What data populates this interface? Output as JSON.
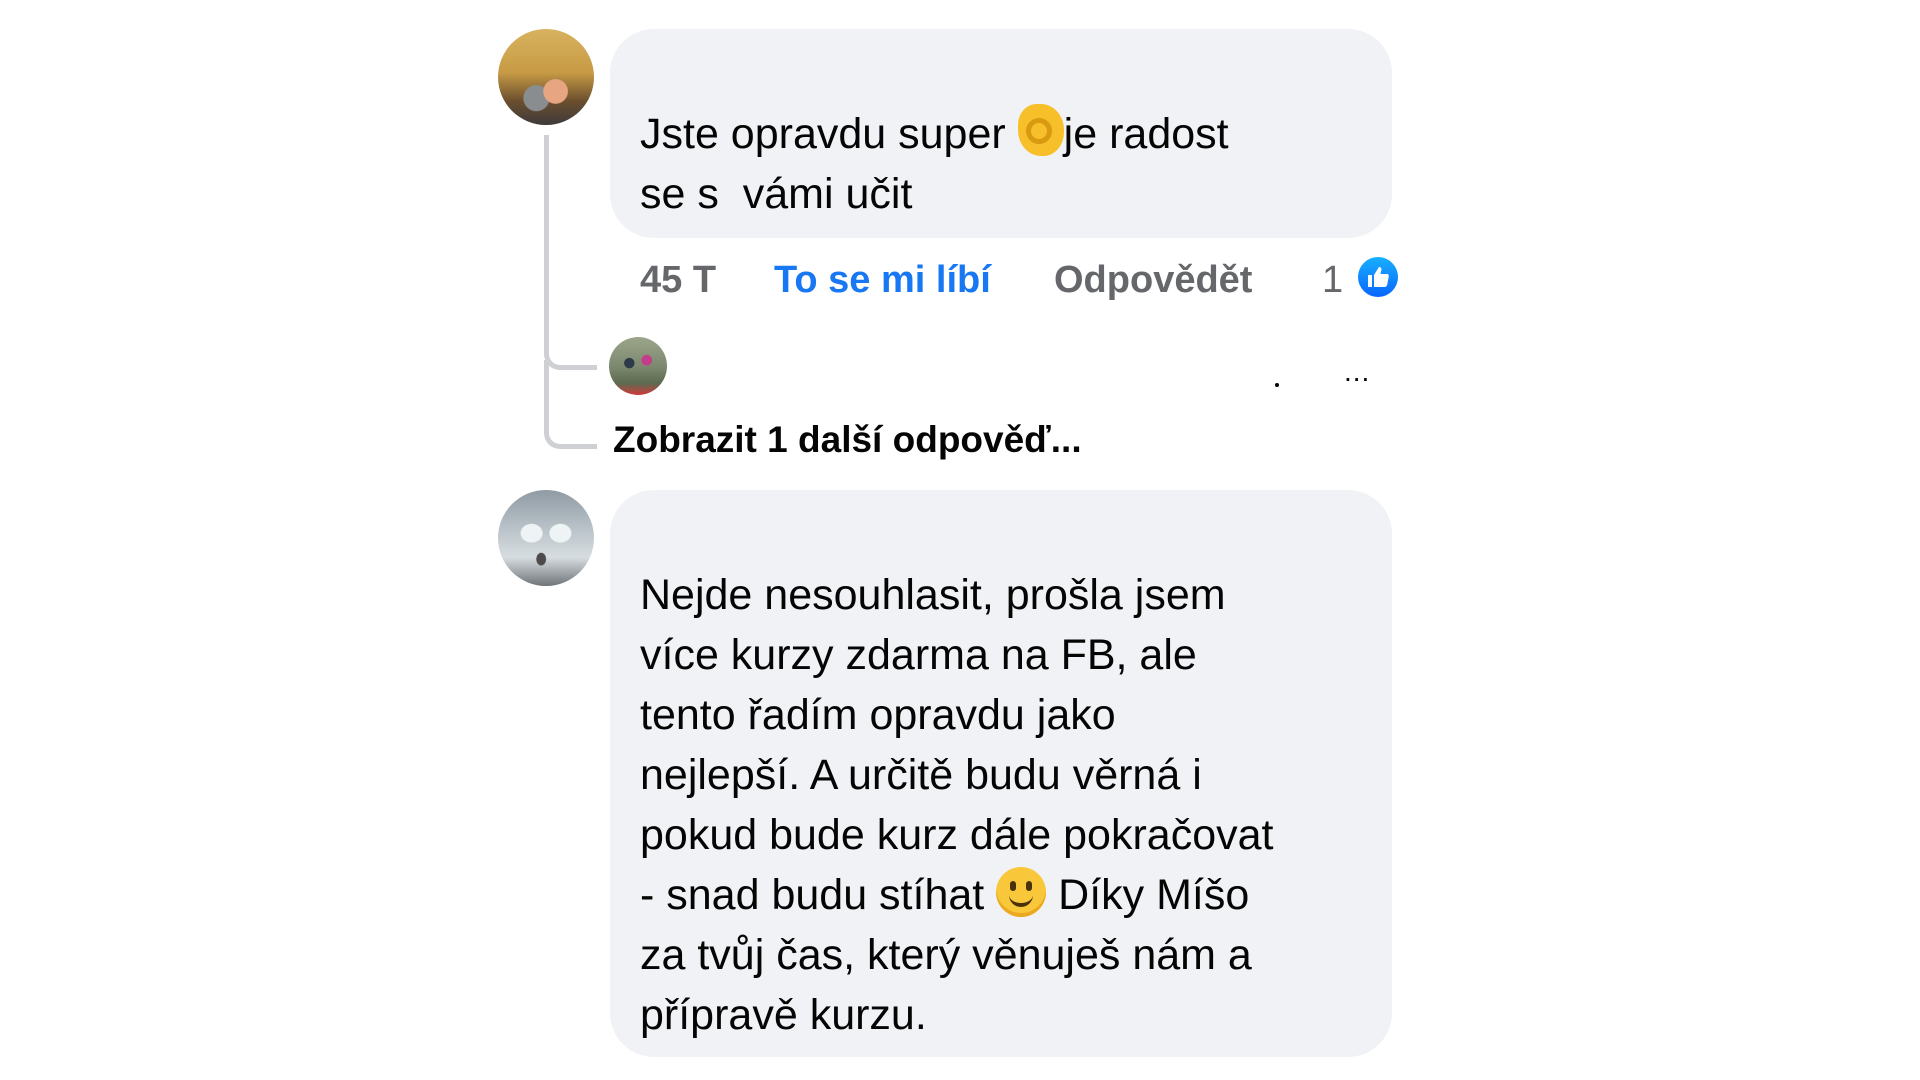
{
  "comments": [
    {
      "text_before_emoji": "Jste opravdu super ",
      "emoji": "ok-hand-emoji",
      "text_after_emoji": "je radost\nse s  vámi učit",
      "time": "45 T",
      "like_label": "To se mi líbí",
      "reply_label": "Odpovědět",
      "reaction_count": "1",
      "reaction_icon": "like-reaction-icon",
      "reply_preview": "...",
      "more_replies_label": "Zobrazit 1 další odpověď..."
    },
    {
      "text_before_emoji": "Nejde nesouhlasit, prošla jsem\nvíce kurzy zdarma na FB, ale\ntento řadím opravdu jako\nnejlepší. A určitě budu věrná i\npokud bude kurz dále pokračovat\n- snad budu stíhat ",
      "emoji": "smiling-face-emoji",
      "text_after_emoji": " Díky Míšo\nza tvůj čas, který věnuješ nám a\npřípravě kurzu."
    }
  ],
  "colors": {
    "bubble_bg": "#f0f2f5",
    "like_blue": "#1877f2",
    "meta_gray": "#65676b",
    "thread_line": "#ced0d4"
  }
}
